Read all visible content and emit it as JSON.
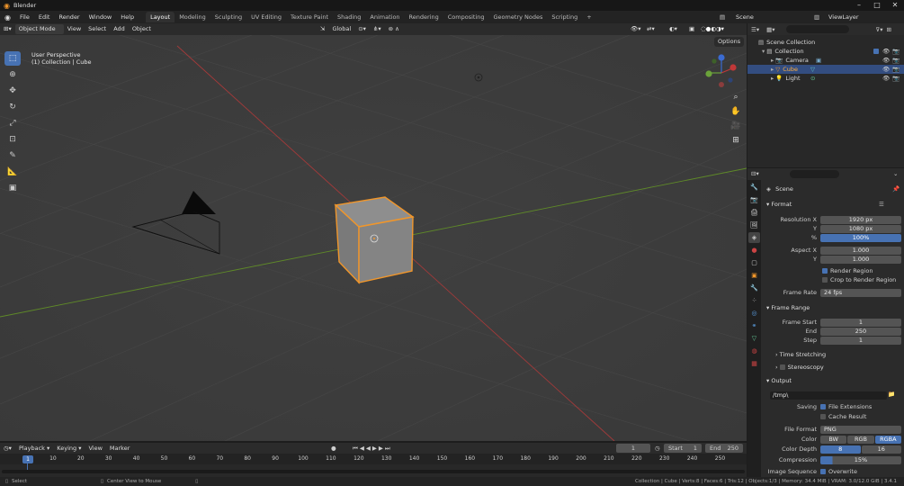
{
  "window": {
    "title": "Blender"
  },
  "menu": [
    "File",
    "Edit",
    "Render",
    "Window",
    "Help"
  ],
  "workspaces": [
    "Layout",
    "Modeling",
    "Sculpting",
    "UV Editing",
    "Texture Paint",
    "Shading",
    "Animation",
    "Rendering",
    "Compositing",
    "Geometry Nodes",
    "Scripting"
  ],
  "active_workspace": "Layout",
  "scene_name": "Scene",
  "view_layer": "ViewLayer",
  "header3d": {
    "mode": "Object Mode",
    "view": "View",
    "select": "Select",
    "add": "Add",
    "object": "Object",
    "transform": "Global",
    "options": "Options"
  },
  "viewport": {
    "perspective": "User Perspective",
    "collection_info": "(1) Collection | Cube"
  },
  "outliner": {
    "root": "Scene Collection",
    "collection": "Collection",
    "items": [
      "Camera",
      "Cube",
      "Light"
    ]
  },
  "properties": {
    "context": "Scene",
    "format_header": "Format",
    "resolution_x_label": "Resolution X",
    "resolution_x": "1920 px",
    "y_label": "Y",
    "resolution_y": "1080 px",
    "pct_label": "%",
    "resolution_pct": "100%",
    "aspect_x_label": "Aspect X",
    "aspect_x": "1.000",
    "aspect_y": "1.000",
    "render_region": "Render Region",
    "crop_region": "Crop to Render Region",
    "frame_rate_label": "Frame Rate",
    "frame_rate": "24 fps",
    "frame_range_header": "Frame Range",
    "frame_start_label": "Frame Start",
    "frame_start": "1",
    "end_label": "End",
    "frame_end": "250",
    "step_label": "Step",
    "frame_step": "1",
    "time_stretching": "Time Stretching",
    "stereoscopy": "Stereoscopy",
    "output_header": "Output",
    "output_path": "/tmp\\",
    "saving_label": "Saving",
    "file_extensions": "File Extensions",
    "cache_result": "Cache Result",
    "file_format_label": "File Format",
    "file_format": "PNG",
    "color_label": "Color",
    "color_bw": "BW",
    "color_rgb": "RGB",
    "color_rgba": "RGBA",
    "color_depth_label": "Color Depth",
    "depth_8": "8",
    "depth_16": "16",
    "compression_label": "Compression",
    "compression": "15%",
    "image_sequence_label": "Image Sequence",
    "overwrite": "Overwrite"
  },
  "timeline": {
    "playback": "Playback",
    "keying": "Keying",
    "view": "View",
    "marker": "Marker",
    "current_frame": "1",
    "start_label": "Start",
    "start": "1",
    "end_label": "End",
    "end": "250",
    "ticks": [
      "10",
      "20",
      "30",
      "40",
      "50",
      "60",
      "70",
      "80",
      "90",
      "100",
      "110",
      "120",
      "130",
      "140",
      "150",
      "160",
      "170",
      "180",
      "190",
      "200",
      "210",
      "220",
      "230",
      "240",
      "250"
    ],
    "playhead": "1"
  },
  "statusbar": {
    "select": "Select",
    "center_view": "Center View to Mouse",
    "info": "Collection | Cube | Verts:8 | Faces:6 | Tris:12 | Objects:1/3 | Memory: 34.4 MiB | VRAM: 3.0/12.0 GiB | 3.4.1"
  },
  "colors": {
    "accent": "#4772b3",
    "selection": "#f0962b",
    "x_axis": "#b03a3a",
    "y_axis": "#6c9a2a"
  }
}
